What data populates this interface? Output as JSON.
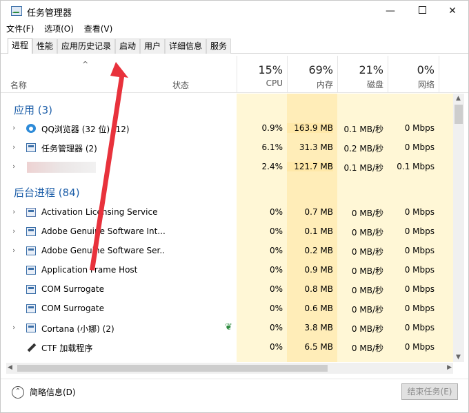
{
  "window": {
    "title": "任务管理器",
    "controls": {
      "minimize": "—",
      "maximize": "",
      "close": "✕"
    }
  },
  "menu": [
    "文件(F)",
    "选项(O)",
    "查看(V)"
  ],
  "tabs": [
    {
      "label": "进程",
      "active": true
    },
    {
      "label": "性能",
      "active": false
    },
    {
      "label": "应用历史记录",
      "active": false
    },
    {
      "label": "启动",
      "active": false
    },
    {
      "label": "用户",
      "active": false
    },
    {
      "label": "详细信息",
      "active": false
    },
    {
      "label": "服务",
      "active": false
    }
  ],
  "header": {
    "sort_arrow": "^",
    "name": "名称",
    "status": "状态",
    "columns": [
      {
        "pct": "15%",
        "label": "CPU"
      },
      {
        "pct": "69%",
        "label": "内存"
      },
      {
        "pct": "21%",
        "label": "磁盘"
      },
      {
        "pct": "0%",
        "label": "网络"
      }
    ]
  },
  "sections": {
    "apps": "应用 (3)",
    "background": "后台进程 (84)"
  },
  "apps": [
    {
      "icon": "qq-browser-icon",
      "name": "QQ浏览器 (32 位) (12)",
      "cpu": "0.9%",
      "mem": "163.9 MB",
      "disk": "0.1 MB/秒",
      "net": "0 Mbps",
      "expand": true
    },
    {
      "icon": "task-manager-icon",
      "name": "任务管理器 (2)",
      "cpu": "6.1%",
      "mem": "31.3 MB",
      "disk": "0.2 MB/秒",
      "net": "0 Mbps",
      "expand": true
    },
    {
      "icon": "blurred-icon",
      "name": "",
      "cpu": "2.4%",
      "mem": "121.7 MB",
      "disk": "0.1 MB/秒",
      "net": "0.1 Mbps",
      "expand": true
    }
  ],
  "background": [
    {
      "icon": "activation-icon",
      "name": "Activation Licensing Service",
      "cpu": "0%",
      "mem": "0.7 MB",
      "disk": "0 MB/秒",
      "net": "0 Mbps",
      "expand": true
    },
    {
      "icon": "window-icon",
      "name": "Adobe Genuine Software Int...",
      "cpu": "0%",
      "mem": "0.1 MB",
      "disk": "0 MB/秒",
      "net": "0 Mbps",
      "expand": true
    },
    {
      "icon": "window-icon",
      "name": "Adobe Genuine Software Ser...",
      "cpu": "0%",
      "mem": "0.2 MB",
      "disk": "0 MB/秒",
      "net": "0 Mbps",
      "expand": true
    },
    {
      "icon": "window-icon",
      "name": "Application Frame Host",
      "cpu": "0%",
      "mem": "0.9 MB",
      "disk": "0 MB/秒",
      "net": "0 Mbps",
      "expand": false
    },
    {
      "icon": "window-icon",
      "name": "COM Surrogate",
      "cpu": "0%",
      "mem": "0.8 MB",
      "disk": "0 MB/秒",
      "net": "0 Mbps",
      "expand": false
    },
    {
      "icon": "window-icon",
      "name": "COM Surrogate",
      "cpu": "0%",
      "mem": "0.6 MB",
      "disk": "0 MB/秒",
      "net": "0 Mbps",
      "expand": false
    },
    {
      "icon": "window-icon",
      "name": "Cortana (小娜) (2)",
      "cpu": "0%",
      "mem": "3.8 MB",
      "disk": "0 MB/秒",
      "net": "0 Mbps",
      "expand": true,
      "status_icon": "leaf-icon"
    },
    {
      "icon": "pen-icon",
      "name": "CTF 加载程序",
      "cpu": "0%",
      "mem": "6.5 MB",
      "disk": "0 MB/秒",
      "net": "0 Mbps",
      "expand": false
    }
  ],
  "footer": {
    "fewer_details": "简略信息(D)",
    "end_task": "结束任务(E)"
  },
  "colors": {
    "accent_text": "#1e5fa9",
    "column_highlight": "#fff7d6",
    "strong_highlight": "#ffe8a8",
    "annotation_arrow": "#e8323c"
  }
}
